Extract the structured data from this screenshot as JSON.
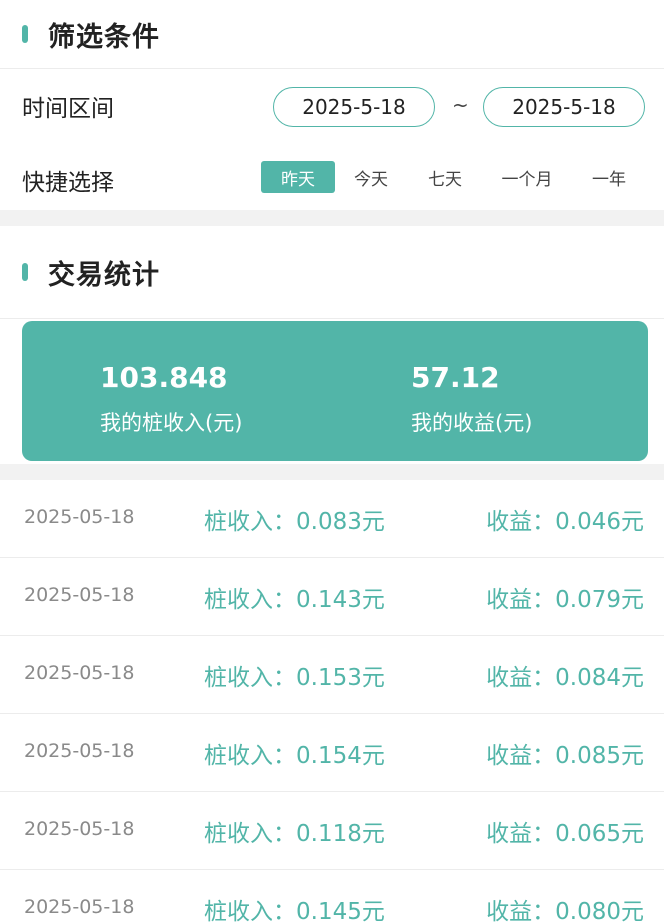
{
  "filter": {
    "title": "筛选条件",
    "time_label": "时间区间",
    "start_date": "2025-5-18",
    "separator": "~",
    "end_date": "2025-5-18",
    "quick_label": "快捷选择",
    "quick_options": [
      "昨天",
      "今天",
      "七天",
      "一个月",
      "一年"
    ],
    "selected": "昨天"
  },
  "stats": {
    "title": "交易统计",
    "pile_income_value": "103.848",
    "pile_income_label": "我的桩收入(元)",
    "profit_value": "57.12",
    "profit_label": "我的收益(元)"
  },
  "records": [
    {
      "date": "2025-05-18",
      "income": "桩收入：0.083元",
      "profit": "收益：0.046元"
    },
    {
      "date": "2025-05-18",
      "income": "桩收入：0.143元",
      "profit": "收益：0.079元"
    },
    {
      "date": "2025-05-18",
      "income": "桩收入：0.153元",
      "profit": "收益：0.084元"
    },
    {
      "date": "2025-05-18",
      "income": "桩收入：0.154元",
      "profit": "收益：0.085元"
    },
    {
      "date": "2025-05-18",
      "income": "桩收入：0.118元",
      "profit": "收益：0.065元"
    },
    {
      "date": "2025-05-18",
      "income": "桩收入：0.145元",
      "profit": "收益：0.080元"
    }
  ],
  "colors": {
    "accent": "#52b5a8",
    "background": "#f2f2f2"
  }
}
